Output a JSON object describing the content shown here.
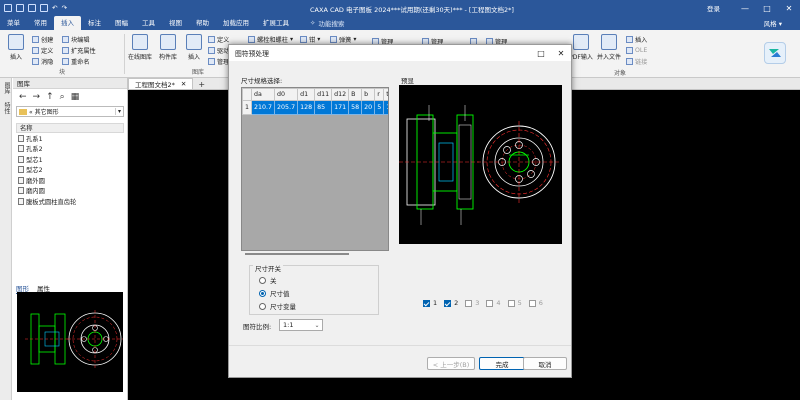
{
  "titlebar": {
    "title": "CAXA CAD 电子图板 2024***试用期(还剩30天)*** - [工程图文档2*]",
    "login": "登录",
    "minimize": "—",
    "maximize": "□",
    "close": "✕"
  },
  "menu": {
    "tabs": [
      "菜单",
      "常用",
      "插入",
      "标注",
      "图幅",
      "工具",
      "视图",
      "帮助",
      "加载应用",
      "扩展工具"
    ],
    "active": "插入",
    "search_placeholder": "功能搜索",
    "style": "风格"
  },
  "ribbon": {
    "insert_label": "插入",
    "block_create": "创建",
    "block_define": "定义",
    "block_erase": "消隐",
    "block_edit": "块编辑",
    "block_ext_attr": "扩充属性",
    "block_rename": "重命名",
    "block_group": "块",
    "lib_map": "在线图库",
    "lib_part": "构件库",
    "lib_insert": "插入",
    "lib_define": "定义",
    "lib_drive": "驱动",
    "lib_manage": "管理",
    "lib_bolt": "螺栓和螺柱",
    "lib_bolt2": "螺柱",
    "lib_nut": "螺母",
    "lib_screw": "钳",
    "lib_group": "图库",
    "lib_sheet": "弹簧",
    "m1": "管理",
    "m2": "管理",
    "m3": "管理",
    "pdf_input": "PDF输入",
    "insert_file": "并入文件",
    "obj_insert": "插入",
    "obj_ole": "OLE",
    "obj_link": "链接",
    "obj_group": "对象"
  },
  "left_panel": {
    "vtab1": "图库",
    "vtab2": "特性",
    "title": "图库",
    "path": "« 其它图形",
    "column_header": "名称",
    "items": [
      "孔系1",
      "孔系2",
      "型芯1",
      "型芯2",
      "磨外圆",
      "磨内圆",
      "腹板式圆柱直齿轮"
    ],
    "tab_graphic": "图形",
    "tab_attr": "属性"
  },
  "doc": {
    "tab_label": "工程图文档2*",
    "close": "✕",
    "add": "+"
  },
  "dialog": {
    "title": "图符预处理",
    "spec_label": "尺寸规格选择:",
    "preview_label": "预显",
    "columns": [
      "",
      "da",
      "d0",
      "d1",
      "d11",
      "d12",
      "B",
      "b",
      "r",
      "t",
      "d"
    ],
    "rows": [
      [
        "1",
        "210.7",
        "205.7",
        "128",
        "85",
        "171",
        "58",
        "20",
        "5",
        "14",
        "50"
      ]
    ],
    "dim_switch": "尺寸开关",
    "radio_off": "关",
    "radio_value": "尺寸值",
    "radio_variable": "尺寸变量",
    "scale_label": "图符比例:",
    "scale_value": "1:1",
    "views": [
      "1",
      "2",
      "3",
      "4",
      "5",
      "6"
    ],
    "views_checked": [
      true,
      true,
      false,
      false,
      false,
      false
    ],
    "btn_prev": "< 上一步(B)",
    "btn_finish": "完成",
    "btn_cancel": "取消",
    "minimize": "□",
    "close": "✕"
  },
  "colors": {
    "title_blue": "#2b579a",
    "selection_blue": "#0078d7",
    "drawing_green": "#00ff00",
    "drawing_red": "#ff3030",
    "drawing_white": "#ffffff"
  }
}
